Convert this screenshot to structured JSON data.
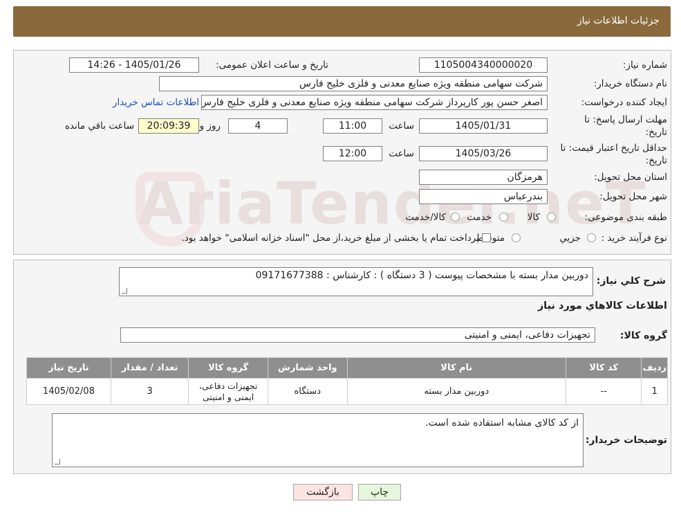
{
  "header": {
    "title": "جزئیات اطلاعات نیاز"
  },
  "form": {
    "need_number_label": "شماره نیاز:",
    "need_number": "1105004340000020",
    "announce_label": "تاریخ و ساعت اعلان عمومی:",
    "announce_value": "1405/01/26 - 14:26",
    "buyer_org_label": "نام دستگاه خریدار:",
    "buyer_org": "شرکت سهامی منطقه ویژه صنایع معدنی و فلزی خلیج فارس",
    "requester_label": "ایجاد کننده درخواست:",
    "requester": "اصغر حسن پور کارپرداز شرکت سهامی منطقه ویژه صنایع معدنی و فلزی خلیج فارس",
    "buyer_contact_link": "اطلاعات تماس خریدار",
    "deadline_label_1": "مهلت ارسال پاسخ: تا",
    "deadline_label_2": "تاریخ:",
    "deadline_date": "1405/01/31",
    "time_label": "ساعت",
    "deadline_time": "11:00",
    "days_value": "4",
    "days_label": "روز و",
    "remaining_time": "20:09:39",
    "remaining_label": "ساعت باقي مانده",
    "validity_label_1": "حداقل تاریخ اعتبار قیمت: تا",
    "validity_label_2": "تاریخ:",
    "validity_date": "1405/03/26",
    "validity_time": "12:00",
    "province_label": "استان محل تحویل:",
    "province": "هرمزگان",
    "city_label": "شهر محل تحویل:",
    "city": "بندرعباس",
    "category_label": "طبقه بندی موضوعی:",
    "category_options": [
      "کالا",
      "خدمت",
      "کالا/خدمت"
    ],
    "process_label": "نوع فرآیند خرید :",
    "process_options": [
      "جزیي",
      "متوسط"
    ],
    "process_note": "پرداخت تمام یا بخشی از مبلغ خرید،از محل \"اسناد خزانه اسلامی\" خواهد بود."
  },
  "watermark": {
    "text": "AriaTender.neT"
  },
  "details": {
    "description_label": "شرح کلي نياز:",
    "description": "دوربین مدار بسته با مشخصات پیوست   ( 3 دستگاه ) : کارشناس : 09171677388",
    "items_title": "اطلاعات کالاهاي مورد نياز",
    "group_label": "گروه کالا:",
    "group_value": "تجهیزات دفاعی، ایمنی و امنیتی",
    "table": {
      "headers": [
        "ردیف",
        "کد کالا",
        "نام کالا",
        "واحد شمارش",
        "گروه کالا",
        "تعداد / مقدار",
        "تاریخ نیاز"
      ],
      "rows": [
        [
          "1",
          "--",
          "دوربین مدار بسته",
          "دستگاه",
          "تجهیزات دفاعی، ایمنی و امنیتی",
          "3",
          "1405/02/08"
        ]
      ]
    },
    "buyer_notes_label": "توضیحات خریدار:",
    "buyer_notes": "از کد کالای مشابه استفاده شده است."
  },
  "buttons": {
    "print": "چاپ",
    "back": "بازگشت"
  },
  "colors": {
    "header": "#8a6a3c",
    "link": "#1a4fbf",
    "back_button": "#fde4e4",
    "print_button": "#e6f6dc"
  }
}
